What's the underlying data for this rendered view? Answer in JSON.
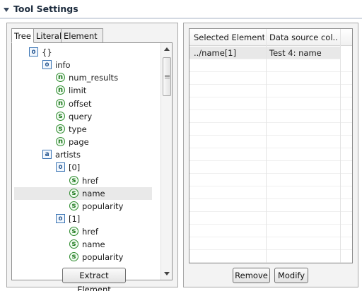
{
  "section": {
    "title": "Tool Settings"
  },
  "tabs": [
    {
      "label": "Tree",
      "active": true
    },
    {
      "label": "Literal",
      "active": false
    },
    {
      "label": "Element",
      "active": false
    }
  ],
  "tree": {
    "nodes": [
      {
        "icon": "o",
        "label": "{}",
        "depth": 0,
        "selected": false
      },
      {
        "icon": "o",
        "label": "info",
        "depth": 1,
        "selected": false
      },
      {
        "icon": "n",
        "label": "num_results",
        "depth": 2,
        "selected": false
      },
      {
        "icon": "n",
        "label": "limit",
        "depth": 2,
        "selected": false
      },
      {
        "icon": "n",
        "label": "offset",
        "depth": 2,
        "selected": false
      },
      {
        "icon": "s",
        "label": "query",
        "depth": 2,
        "selected": false
      },
      {
        "icon": "s",
        "label": "type",
        "depth": 2,
        "selected": false
      },
      {
        "icon": "n",
        "label": "page",
        "depth": 2,
        "selected": false
      },
      {
        "icon": "a",
        "label": "artists",
        "depth": 1,
        "selected": false
      },
      {
        "icon": "o",
        "label": "[0]",
        "depth": 2,
        "selected": false
      },
      {
        "icon": "s",
        "label": "href",
        "depth": 3,
        "selected": false
      },
      {
        "icon": "s",
        "label": "name",
        "depth": 3,
        "selected": true
      },
      {
        "icon": "s",
        "label": "popularity",
        "depth": 3,
        "selected": false
      },
      {
        "icon": "o",
        "label": "[1]",
        "depth": 2,
        "selected": false
      },
      {
        "icon": "s",
        "label": "href",
        "depth": 3,
        "selected": false
      },
      {
        "icon": "s",
        "label": "name",
        "depth": 3,
        "selected": false
      },
      {
        "icon": "s",
        "label": "popularity",
        "depth": 3,
        "selected": false
      }
    ]
  },
  "buttons": {
    "extract": "Extract Element",
    "remove": "Remove",
    "modify": "Modify"
  },
  "table": {
    "columns": [
      "Selected Elements",
      "Data source col..."
    ],
    "rows": [
      {
        "selected_element": "../name[1]",
        "data_source": "Test 4: name"
      }
    ]
  },
  "colors": {
    "accent_header": "#1c2b3d",
    "object_icon": "#3a74b4",
    "value_icon": "#2e8b2e"
  }
}
